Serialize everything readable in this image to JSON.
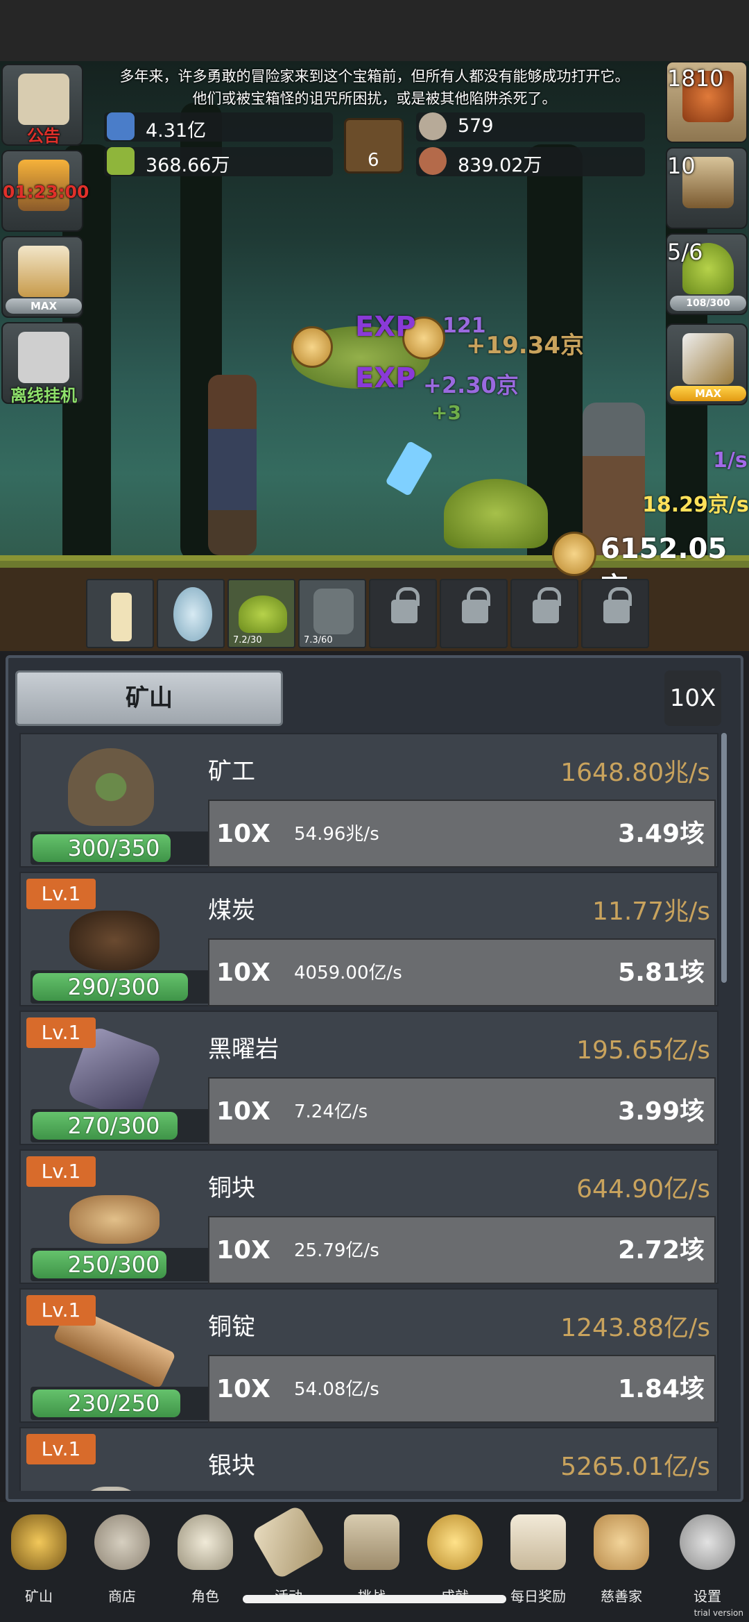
{
  "story": {
    "line1": "多年来，许多勇敢的冒险家来到这个宝箱前，但所有人都没有能够成功打开它。",
    "line2": "他们或被宝箱怪的诅咒所困扰，或是被其他陷阱杀死了。"
  },
  "resources": {
    "blue_potion": "4.31亿",
    "green_potion": "368.66万",
    "book_count": "6",
    "stone": "579",
    "meat": "839.02万"
  },
  "left_buttons": {
    "notice_label": "公告",
    "torch_timer": "01:23:00",
    "beer_max": "MAX",
    "offline_label": "离线挂机"
  },
  "right_buttons": {
    "potion_count": "1810",
    "chest_count": "10",
    "slime_count": "5/6",
    "slime_progress": "108/300",
    "sword_max": "MAX"
  },
  "battle": {
    "exp_text_1": "EXP",
    "exp_text_2": "EXP",
    "float_1": "121",
    "float_2": "+19.34京",
    "float_3": "+2.30京",
    "float_4": "+3",
    "per_second": "1/s",
    "damage_rate": "18.29京/s",
    "gold_total": "6152.05京"
  },
  "pet_slots": [
    {
      "name": "candle",
      "text": ""
    },
    {
      "name": "egg",
      "text": ""
    },
    {
      "name": "slime",
      "text": "7.2/30"
    },
    {
      "name": "zombie",
      "text": "7.3/60"
    }
  ],
  "panel": {
    "tab_label": "矿山",
    "multiplier": "10X"
  },
  "mine_items": [
    {
      "level": "",
      "progress": "300/350",
      "fill": 0.857,
      "name": "矿工",
      "rate": "1648.80兆/s",
      "mult": "10X",
      "increment": "54.96兆/s",
      "cost": "3.49垓"
    },
    {
      "level": "Lv.1",
      "progress": "290/300",
      "fill": 0.967,
      "name": "煤炭",
      "rate": "11.77兆/s",
      "mult": "10X",
      "increment": "4059.00亿/s",
      "cost": "5.81垓"
    },
    {
      "level": "Lv.1",
      "progress": "270/300",
      "fill": 0.9,
      "name": "黑曜岩",
      "rate": "195.65亿/s",
      "mult": "10X",
      "increment": "7.24亿/s",
      "cost": "3.99垓"
    },
    {
      "level": "Lv.1",
      "progress": "250/300",
      "fill": 0.833,
      "name": "铜块",
      "rate": "644.90亿/s",
      "mult": "10X",
      "increment": "25.79亿/s",
      "cost": "2.72垓"
    },
    {
      "level": "Lv.1",
      "progress": "230/250",
      "fill": 0.92,
      "name": "铜锭",
      "rate": "1243.88亿/s",
      "mult": "10X",
      "increment": "54.08亿/s",
      "cost": "1.84垓"
    },
    {
      "level": "Lv.1",
      "progress": "",
      "fill": 0,
      "name": "银块",
      "rate": "5265.01亿/s",
      "mult": "",
      "increment": "",
      "cost": ""
    }
  ],
  "nav": [
    "矿山",
    "商店",
    "角色",
    "活动",
    "挑战",
    "成就",
    "每日奖励",
    "慈善家",
    "设置"
  ],
  "footer": {
    "trial": "trial version"
  },
  "colors": {
    "accent_gold": "#c9a35d",
    "level_orange": "#d86b2b",
    "progress_green": "#4fae58"
  }
}
